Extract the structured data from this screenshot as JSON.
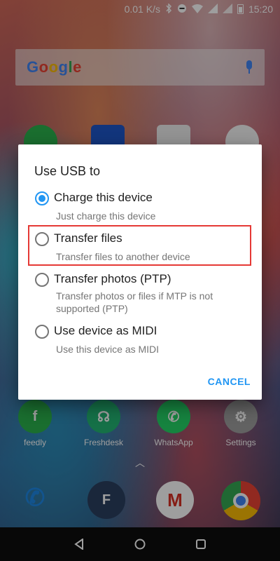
{
  "status_bar": {
    "net_speed": "0.01 K/s",
    "time": "15:20",
    "icons": [
      "bluetooth-icon",
      "dnd-icon",
      "wifi-icon",
      "signal-icon",
      "battery-icon"
    ]
  },
  "search": {
    "logo_text": "Google",
    "icon": "mic-icon"
  },
  "apps_row": [
    {
      "label": "feedly",
      "icon": "feedly-icon",
      "color": "#2bb24c"
    },
    {
      "label": "Freshdesk",
      "icon": "freshdesk-icon",
      "color": "#22b573"
    },
    {
      "label": "WhatsApp",
      "icon": "whatsapp-icon",
      "color": "#25d366"
    },
    {
      "label": "Settings",
      "icon": "settings-icon",
      "color": "#9e9e9e"
    }
  ],
  "dock": [
    {
      "icon": "phone-icon",
      "color": "#1e88e5"
    },
    {
      "icon": "freshdesk-dock-icon",
      "color": "#2a3f5f"
    },
    {
      "icon": "gmail-icon",
      "color": "#ffffff"
    },
    {
      "icon": "chrome-icon",
      "color": "#ffffff"
    }
  ],
  "dialog": {
    "title": "Use USB to",
    "options": [
      {
        "label": "Charge this device",
        "sub": "Just charge this device",
        "checked": true
      },
      {
        "label": "Transfer files",
        "sub": "Transfer files to another device",
        "checked": false
      },
      {
        "label": "Transfer photos (PTP)",
        "sub": "Transfer photos or files if MTP is not supported (PTP)",
        "checked": false
      },
      {
        "label": "Use device as MIDI",
        "sub": "Use this device as MIDI",
        "checked": false
      }
    ],
    "cancel_label": "CANCEL",
    "accent": "#2196f3"
  },
  "nav": [
    "back-icon",
    "home-icon",
    "recents-icon"
  ]
}
